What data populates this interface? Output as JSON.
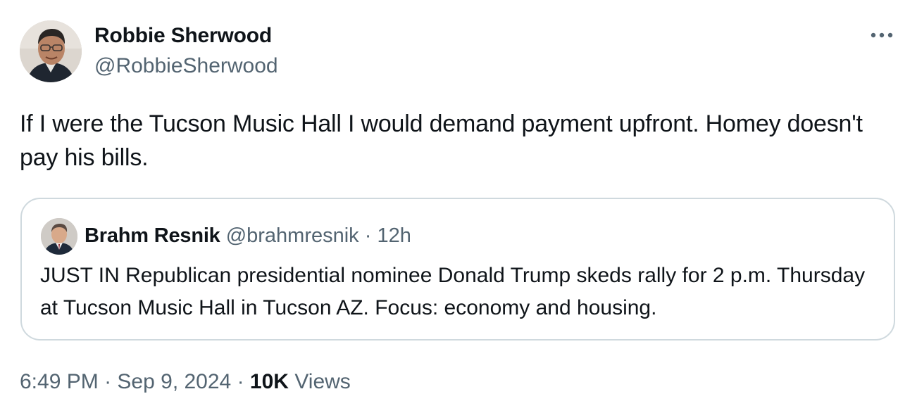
{
  "tweet": {
    "author": {
      "name": "Robbie Sherwood",
      "handle": "@RobbieSherwood"
    },
    "more_icon": "more-horizontal-icon",
    "text": "If I were the Tucson Music Hall I would demand payment upfront. Homey doesn't pay his bills.",
    "quoted": {
      "author_name": "Brahm Resnik",
      "author_handle": "@brahmresnik",
      "separator": "·",
      "age": "12h",
      "text": "JUST IN Republican presidential nominee Donald Trump  skeds rally for 2 p.m. Thursday at Tucson Music Hall in Tucson AZ. Focus:  economy and housing."
    },
    "meta": {
      "time": "6:49 PM",
      "date": "Sep 9, 2024",
      "separator": "·",
      "views_count": "10K",
      "views_label": "Views"
    }
  },
  "colors": {
    "text_primary": "#0f1419",
    "text_secondary": "#536471",
    "border": "#cfd9de"
  }
}
